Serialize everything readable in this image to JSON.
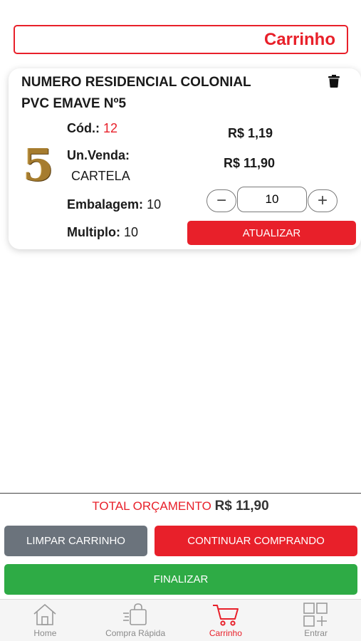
{
  "header": {
    "title": "Carrinho"
  },
  "cart_item": {
    "name_line1": "NUMERO RESIDENCIAL COLONIAL",
    "name_line2": "PVC EMAVE Nº5",
    "thumb_glyph": "5",
    "code_label": "Cód.:",
    "code_value": "12",
    "unit_label": "Un.Venda:",
    "unit_value": "CARTELA",
    "packaging_label": "Embalagem:",
    "packaging_value": "10",
    "multiple_label": "Multiplo:",
    "multiple_value": "10",
    "unit_price": "R$ 1,19",
    "total_price": "R$ 11,90",
    "quantity": "10",
    "decrement_symbol": "−",
    "increment_symbol": "+",
    "update_label": "ATUALIZAR"
  },
  "summary": {
    "total_label": "TOTAL ORÇAMENTO",
    "total_value": "R$ 11,90"
  },
  "actions": {
    "clear_label": "LIMPAR CARRINHO",
    "continue_label": "CONTINUAR COMPRANDO",
    "finish_label": "FINALIZAR"
  },
  "tabs": [
    {
      "label": "Home",
      "icon": "home-icon"
    },
    {
      "label": "Compra Rápida",
      "icon": "quick-buy-icon"
    },
    {
      "label": "Carrinho",
      "icon": "cart-icon",
      "active": true
    },
    {
      "label": "Entrar",
      "icon": "grid-plus-icon"
    }
  ],
  "colors": {
    "accent": "#e8202a",
    "success": "#2eab45",
    "neutral_button": "#6b737c",
    "tab_inactive": "#8a8a8a"
  }
}
